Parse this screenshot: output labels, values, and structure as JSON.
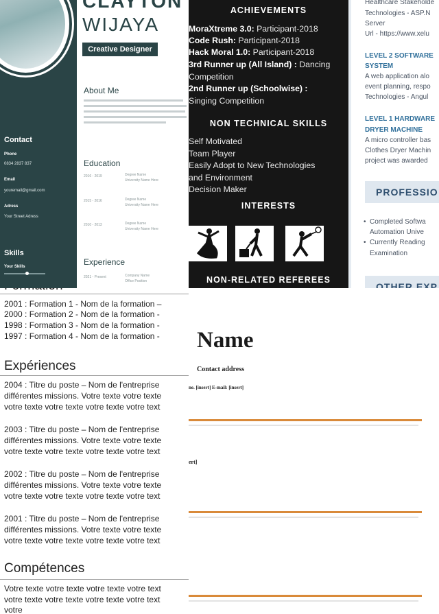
{
  "designer": {
    "name_line1": "CLAYTON",
    "name_line2": "WIJAYA",
    "role": "Creative Designer",
    "about_title": "About Me",
    "education_title": "Education",
    "experience_title": "Experience",
    "contact_title": "Contact",
    "phone_label": "Phone",
    "phone_value": "0834 2837 837",
    "email_label": "Email",
    "email_value": "youremail@gmail.com",
    "address_label": "Adress",
    "address_value": "Your Street Adress",
    "skills_title": "Skills",
    "skill_label": "Your Skills",
    "skill_level": 0.55,
    "education_rows": [
      {
        "years": "2016 - 2019",
        "degree": "Degree Name",
        "school": "University Name Here"
      },
      {
        "years": "2015 - 2016",
        "degree": "Degree Name",
        "school": "University Name Here"
      },
      {
        "years": "2010 - 2013",
        "degree": "Degree Name",
        "school": "University Name Here"
      }
    ],
    "experience_row": {
      "years": "2021 - Present",
      "company": "Company Name",
      "position": "Office Position"
    }
  },
  "achievements": {
    "title": "ACHIEVEMENTS",
    "items": [
      {
        "bold": "MoraXtreme 3.0:",
        "rest": " Participant-2018"
      },
      {
        "bold": "Code Rush:",
        "rest": " Participant-2018"
      },
      {
        "bold": "Hack Moral 1.0:",
        "rest": " Participant-2018"
      },
      {
        "bold": "3rd Runner up (All Island) :",
        "rest": " Dancing"
      },
      {
        "bold": "",
        "rest": "Competition"
      },
      {
        "bold": "2nd Runner up (Schoolwise) :",
        "rest": ""
      },
      {
        "bold": "",
        "rest": "Singing Competition"
      }
    ],
    "non_tech_title": "NON TECHNICAL SKILLS",
    "non_tech": [
      "Self Motivated",
      "Team Player",
      "Easily Adopt to New Technologies",
      "and Environment",
      "Decision Maker"
    ],
    "interests_title": "INTERESTS",
    "interest_icons": [
      "dancing-icon",
      "travel-icon",
      "badminton-icon"
    ],
    "referees_title": "NON-RELATED REFEREES"
  },
  "software": {
    "lines_top": [
      "Healthcare Stakeholde",
      "Technologies - ASP.N",
      "Server",
      "Url - https://www.xelu"
    ],
    "h1": [
      "LEVEL 2 SOFTWARE",
      "SYSTEM"
    ],
    "lines_mid": [
      "A web application alo",
      "event planning, respo",
      "Technologies - Angul"
    ],
    "h2": [
      "LEVEL 1 HARDWARE",
      "DRYER MACHINE"
    ],
    "lines_low": [
      "A micro controller bas",
      "Clothes Dryer Machin",
      "project was awarded"
    ],
    "band_title": "PROFESSIO",
    "bullets": [
      [
        "Completed Softwa",
        "Automation Unive"
      ],
      [
        "Currently Reading",
        "Examination"
      ]
    ],
    "band2_title": "OTHER EXP"
  },
  "french": {
    "formation_title": "Formation",
    "formations": [
      "2001 : Formation 1 - Nom de la formation –",
      "2000 : Formation 2 - Nom de la formation  -",
      "1998 : Formation 3 - Nom de la formation  -",
      "1997 : Formation 4 - Nom de la formation  -"
    ],
    "experiences_title": "Expériences",
    "experiences": [
      [
        "2004 : Titre du poste – Nom de l'entreprise",
        "différentes missions. Votre texte votre texte",
        "votre texte votre texte votre texte votre text"
      ],
      [
        "2003 : Titre du poste – Nom de l'entreprise",
        "différentes missions. Votre texte votre texte",
        "votre texte votre texte votre texte votre text"
      ],
      [
        "2002 : Titre du poste – Nom de l'entreprise",
        "différentes missions. Votre texte votre texte",
        "votre texte votre texte votre texte votre text"
      ],
      [
        "2001 : Titre du poste – Nom de l'entreprise",
        "différentes missions. Votre texte votre texte",
        "votre texte votre texte votre texte votre text"
      ]
    ],
    "competences_title": "Compétences",
    "competences": [
      "Votre texte votre texte votre texte votre text",
      "votre texte votre texte votre texte votre text",
      "votre"
    ]
  },
  "template": {
    "name": "Name",
    "contact_address": "Contact address",
    "phone_line": "ne. [insert]      E-mail: [insert]",
    "mid_fragment": "ert]"
  },
  "colors": {
    "teal": "#2a4446",
    "orange": "#d98a3a",
    "blue": "#2f6f9a"
  }
}
